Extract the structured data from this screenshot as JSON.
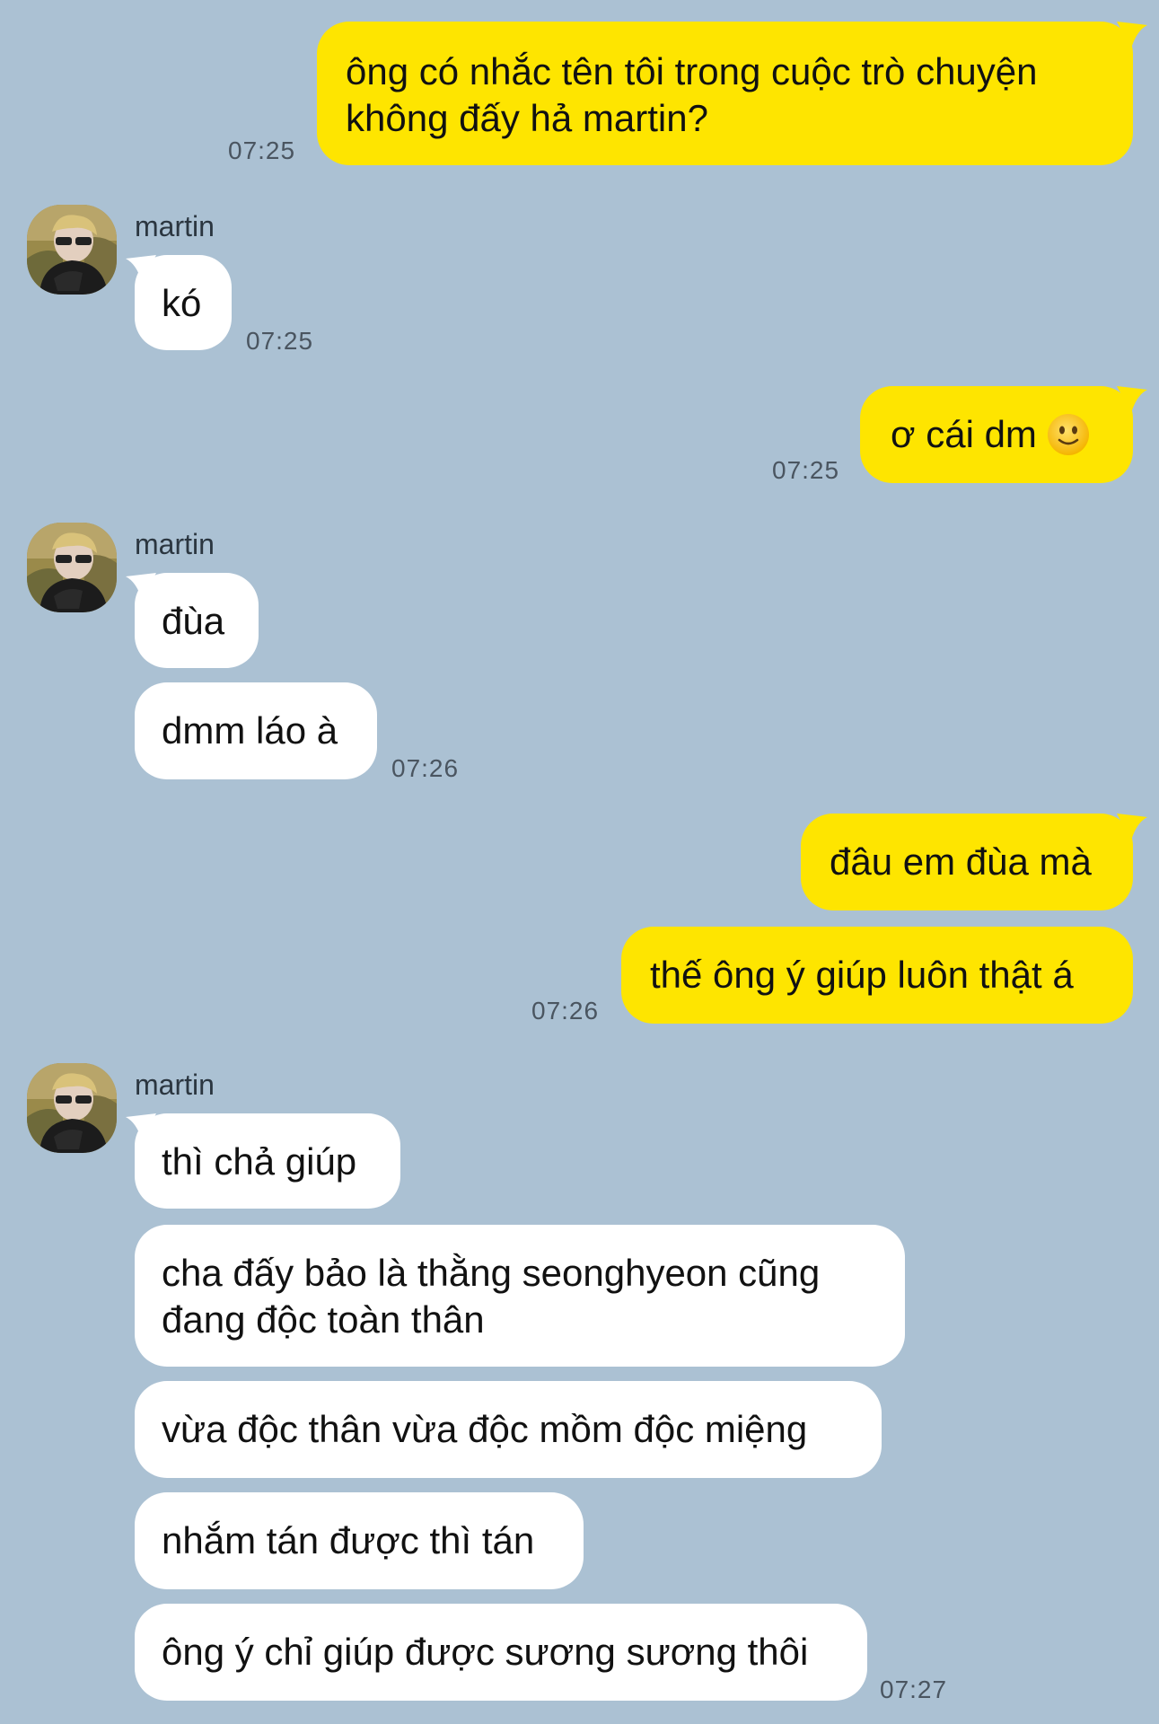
{
  "contact_name": "martin",
  "messages": {
    "m1": {
      "text": "ông có nhắc tên tôi trong cuộc trò chuyện\nkhông đấy hả martin?",
      "time": "07:25"
    },
    "m2": {
      "text": "kó",
      "time": "07:25"
    },
    "m3": {
      "text": "ơ cái dm",
      "emoji": "slightly-smiling-face",
      "time": "07:25"
    },
    "m4": {
      "text": "đùa"
    },
    "m5": {
      "text": "dmm láo à",
      "time": "07:26"
    },
    "m6": {
      "text": "đâu em đùa mà"
    },
    "m7": {
      "text": "thế ông ý giúp luôn thật á",
      "time": "07:26"
    },
    "m8": {
      "text": "thì chả giúp"
    },
    "m9": {
      "text": "cha đấy bảo là thằng seonghyeon cũng\nđang độc toàn thân"
    },
    "m10": {
      "text": "vừa độc thân vừa độc mồm độc miệng"
    },
    "m11": {
      "text": "nhắm tán được thì tán"
    },
    "m12": {
      "text": "ông ý chỉ giúp được sương sương thôi",
      "time": "07:27"
    }
  },
  "colors": {
    "background": "#abc1d3",
    "outgoing_bubble": "#fee500",
    "incoming_bubble": "#ffffff"
  }
}
